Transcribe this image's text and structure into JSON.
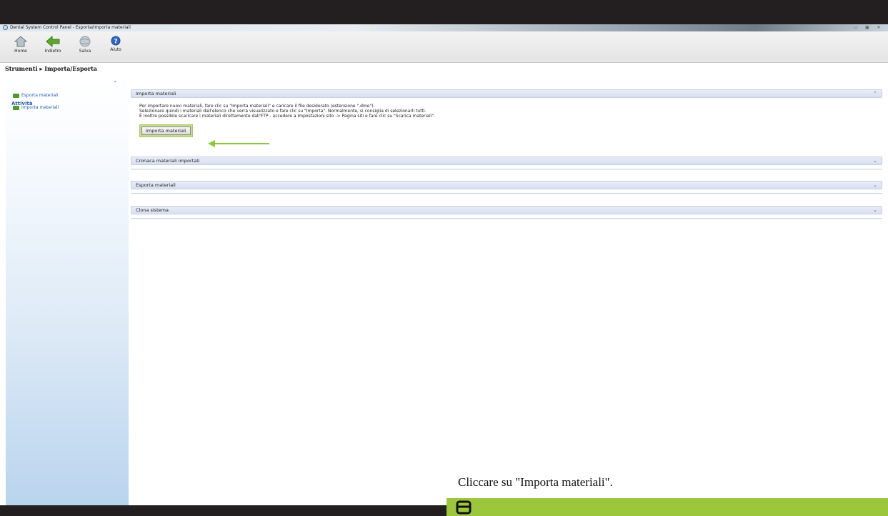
{
  "window": {
    "title": "Dental System Control Panel - Esporta/Importa materiali",
    "controls": [
      "▭",
      "▣",
      "✕"
    ]
  },
  "toolbar": {
    "buttons": [
      {
        "label": "Home",
        "icon": "home-icon"
      },
      {
        "label": "Indietro",
        "icon": "back-arrow-icon"
      },
      {
        "label": "Salva",
        "icon": "save-globe-icon"
      },
      {
        "label": "Aiuto",
        "icon": "help-icon"
      }
    ]
  },
  "breadcrumb": "Strumenti ▸ Importa/Esporta",
  "sidebar": {
    "title": "Attività",
    "collapse_glyph": "⌃",
    "items": [
      {
        "label": "Esporta materiali",
        "icon": "export-icon"
      },
      {
        "label": "Importa materiali",
        "icon": "import-icon"
      }
    ]
  },
  "panels": [
    {
      "title": "Importa materiali",
      "toggle": "⌃",
      "expanded": true,
      "lines": [
        "Per importare nuovi materiali, fare clic su \"Importa materiali\" e caricare il file desiderato (estensione \".dme\").",
        "Selezionare quindi i materiali dall'elenco che verrà visualizzato e fare clic su \"Importa\". Normalmente, si consiglia di selezionarli tutti.",
        "È inoltre possibile scaricare i materiali direttamente dall'FTP - accedere a Impostazioni sito -> Pagina siti e fare clic su \"Scarica materiali\"."
      ],
      "button_label": "Importa materiali"
    },
    {
      "title": "Cronaca materiali importati",
      "toggle": "⌄",
      "expanded": false
    },
    {
      "title": "Esporta materiali",
      "toggle": "⌄",
      "expanded": false
    },
    {
      "title": "Clona sistema",
      "toggle": "⌄",
      "expanded": false
    }
  ],
  "caption": "Cliccare su \"Importa materiali\".",
  "colors": {
    "accent_green": "#9cc63c",
    "link_blue": "#2a5caa",
    "panel_header": "#d7dff0"
  }
}
